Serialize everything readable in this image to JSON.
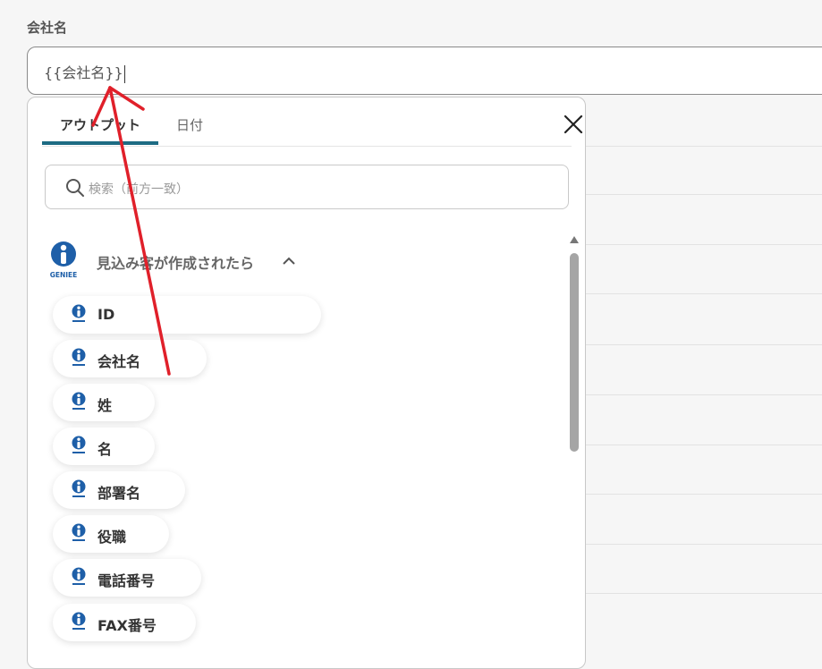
{
  "field": {
    "label": "会社名",
    "value": "{{会社名}}"
  },
  "popup": {
    "tabs": [
      {
        "label": "アウトプット",
        "active": true
      },
      {
        "label": "日付",
        "active": false
      }
    ],
    "search_placeholder": "検索（前方一致）",
    "group": {
      "logo_text": "GENIEE",
      "title": "見込み客が作成されたら"
    },
    "items": [
      {
        "label": "ID"
      },
      {
        "label": "会社名"
      },
      {
        "label": "姓"
      },
      {
        "label": "名"
      },
      {
        "label": "部署名"
      },
      {
        "label": "役職"
      },
      {
        "label": "電話番号"
      },
      {
        "label": "FAX番号"
      }
    ]
  },
  "colors": {
    "accent": "#1d6b83",
    "annotation_arrow": "#e0202a",
    "logo_blue": "#1e5fa8"
  },
  "icons": [
    "close-icon",
    "search-icon",
    "chevron-up-icon",
    "geniee-logo-icon",
    "scroll-up-icon"
  ]
}
